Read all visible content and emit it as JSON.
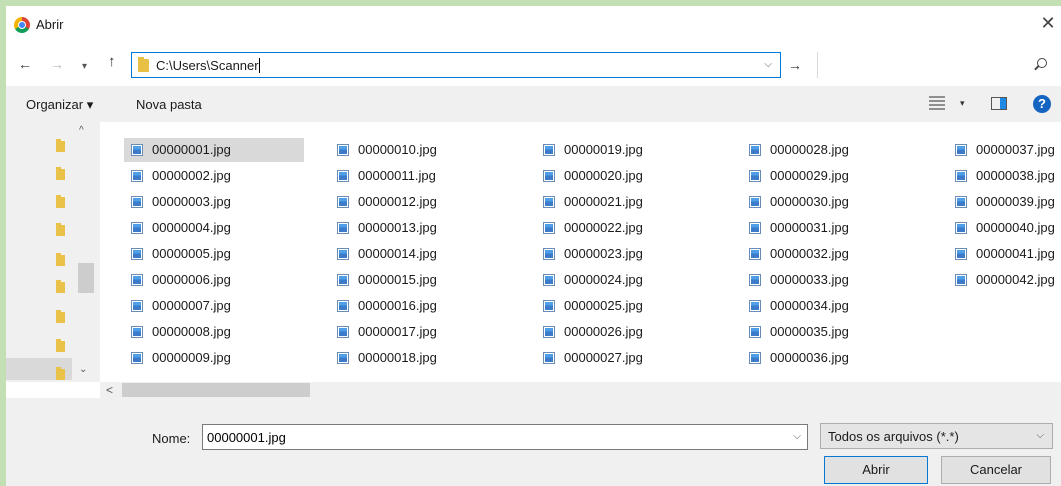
{
  "window": {
    "title": "Abrir",
    "close": "✕"
  },
  "nav": {
    "back": "←",
    "forward": "→",
    "recent": "▾",
    "up": "↑",
    "address": "C:\\Users\\Scanner",
    "address_drop": "⌵",
    "go": "→"
  },
  "toolbar": {
    "organize_label": "Organizar ▾",
    "new_folder_label": "Nova pasta",
    "view_drop": "▾",
    "help": "?"
  },
  "scroll": {
    "up": "^",
    "down": "⌄",
    "left": "<",
    "right": ">"
  },
  "files": [
    "00000001.jpg",
    "00000002.jpg",
    "00000003.jpg",
    "00000004.jpg",
    "00000005.jpg",
    "00000006.jpg",
    "00000007.jpg",
    "00000008.jpg",
    "00000009.jpg",
    "00000010.jpg",
    "00000011.jpg",
    "00000012.jpg",
    "00000013.jpg",
    "00000014.jpg",
    "00000015.jpg",
    "00000016.jpg",
    "00000017.jpg",
    "00000018.jpg",
    "00000019.jpg",
    "00000020.jpg",
    "00000021.jpg",
    "00000022.jpg",
    "00000023.jpg",
    "00000024.jpg",
    "00000025.jpg",
    "00000026.jpg",
    "00000027.jpg",
    "00000028.jpg",
    "00000029.jpg",
    "00000030.jpg",
    "00000031.jpg",
    "00000032.jpg",
    "00000033.jpg",
    "00000034.jpg",
    "00000035.jpg",
    "00000036.jpg",
    "00000037.jpg",
    "00000038.jpg",
    "00000039.jpg",
    "00000040.jpg",
    "00000041.jpg",
    "00000042.jpg"
  ],
  "selected_file": "00000001.jpg",
  "bottom": {
    "name_label": "Nome:",
    "name_value": "00000001.jpg",
    "name_drop": "⌵",
    "filter_label": "Todos os arquivos (*.*)",
    "filter_drop": "⌵",
    "open_label": "Abrir",
    "cancel_label": "Cancelar"
  },
  "colors": {
    "accent": "#0078d7",
    "selection": "#d9d9d9",
    "frame": "#c3dfb4"
  }
}
